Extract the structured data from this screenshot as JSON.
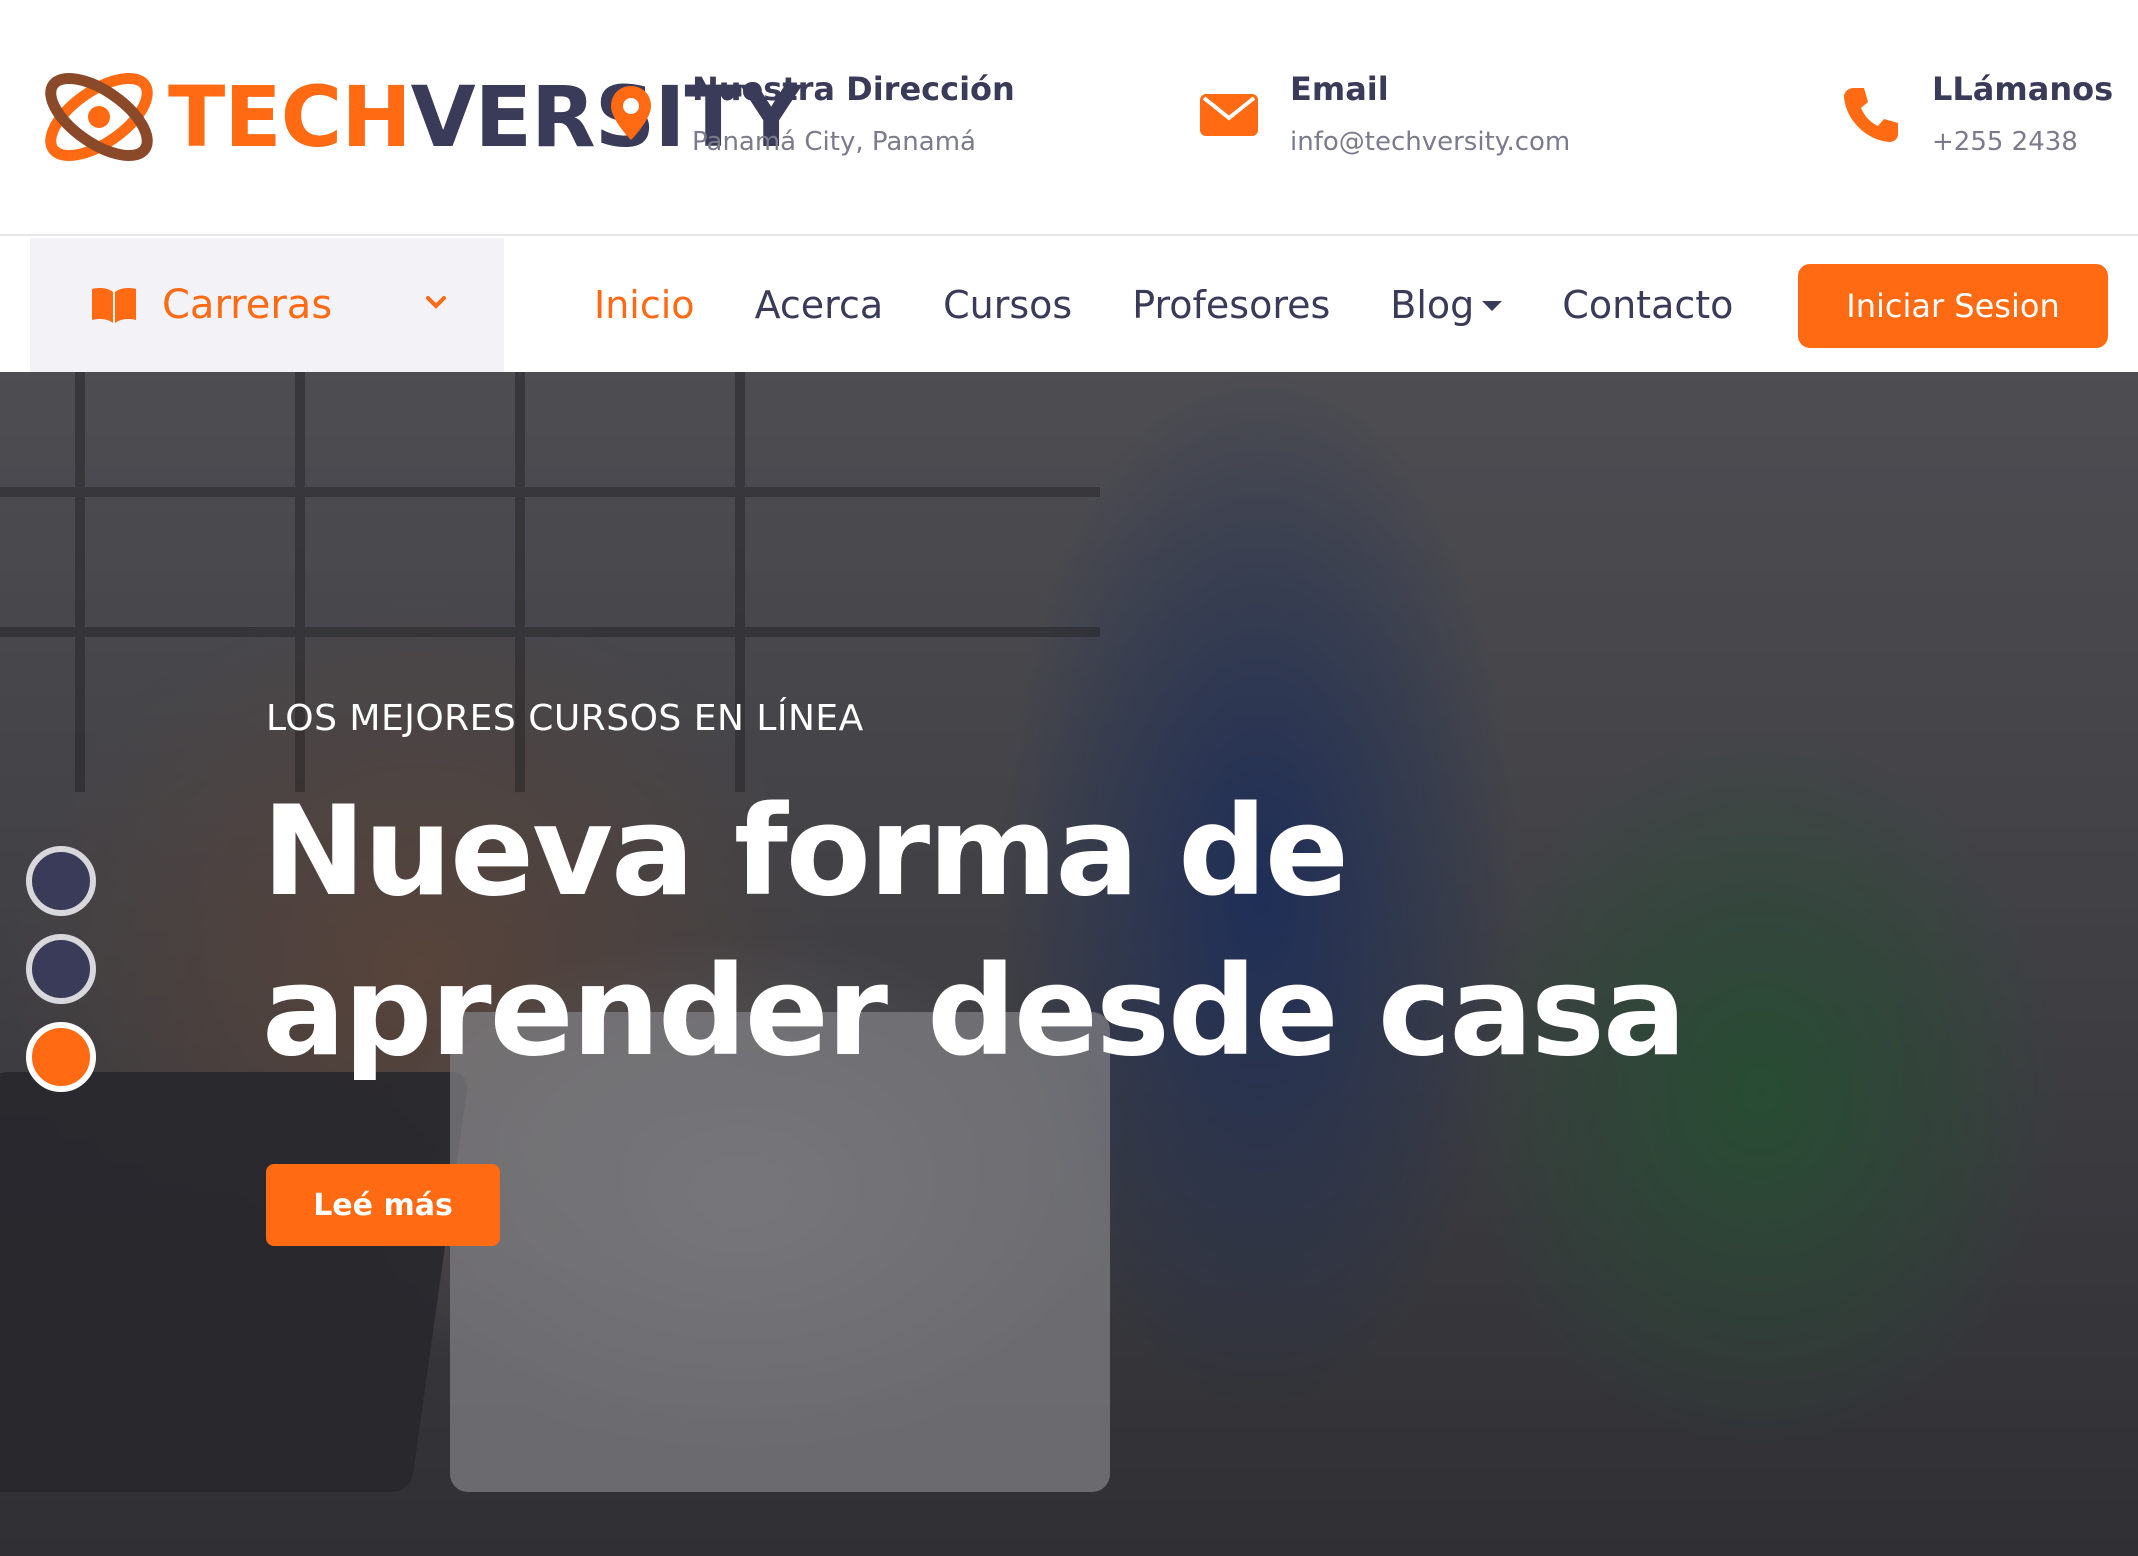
{
  "brand": {
    "name_part1": "TECH",
    "name_part2": "VERSITY",
    "accent_color": "#ff6a13",
    "dark_color": "#3a3a59"
  },
  "contact": {
    "address": {
      "icon": "map-pin-icon",
      "title": "Nuestra Dirección",
      "value": "Panamá City, Panamá"
    },
    "email": {
      "icon": "envelope-icon",
      "title": "Email",
      "value": "info@techversity.com"
    },
    "phone": {
      "icon": "phone-icon",
      "title": "LLámanos",
      "value": "+255 2438"
    }
  },
  "nav": {
    "categories": {
      "icon": "book-icon",
      "label": "Carreras"
    },
    "items": [
      {
        "label": "Inicio",
        "active": true
      },
      {
        "label": "Acerca"
      },
      {
        "label": "Cursos"
      },
      {
        "label": "Profesores"
      },
      {
        "label": "Blog",
        "has_dropdown": true
      },
      {
        "label": "Contacto"
      }
    ],
    "login_label": "Iniciar Sesion"
  },
  "hero": {
    "kicker": "LOS MEJORES CURSOS EN LÍNEA",
    "headline_line1": "Nueva forma de",
    "headline_line2": "aprender desde casa",
    "cta_label": "Leé más",
    "slides_total": 3,
    "slide_active": 3
  }
}
